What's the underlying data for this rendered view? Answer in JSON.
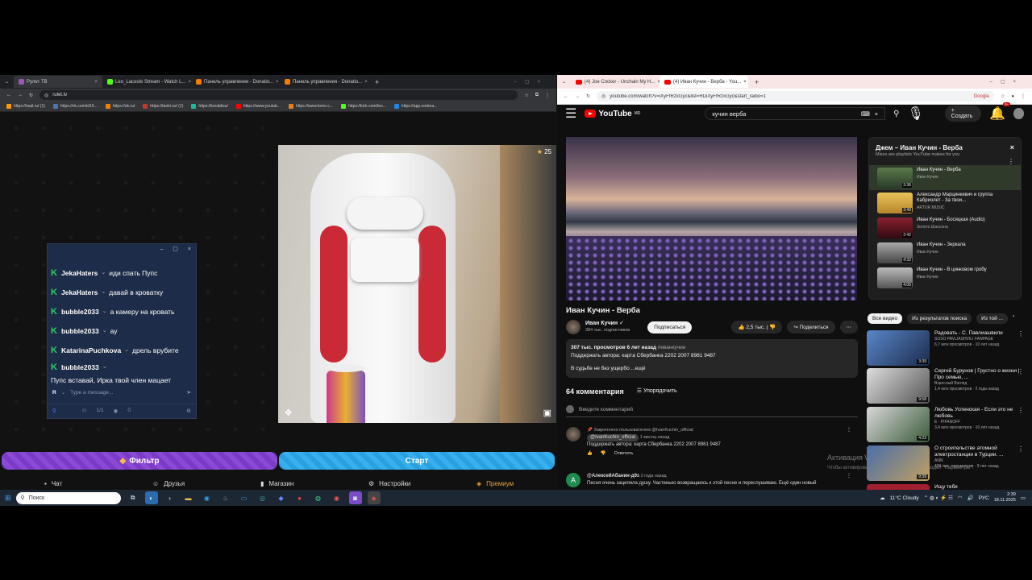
{
  "left_browser": {
    "tabs": [
      {
        "label": "Рулет ТВ",
        "color": "#9b59b6"
      },
      {
        "label": "Leo_Lacoste Stream - Watch L...",
        "color": "#53fc18"
      },
      {
        "label": "Панель управления - Donatio...",
        "color": "#f57c00"
      },
      {
        "label": "Панель управления - Donatio...",
        "color": "#f57c00"
      }
    ],
    "url": "rulet.tv",
    "bookmarks": [
      "https://mail.ru/ (1)",
      "https://vk.com/id19...",
      "https://ok.ru/",
      "https://tanki.su/ (1)",
      "https://korablisu/",
      "https://www.youtub...",
      "https://www.tomo.c...",
      "https://kick.com/leo...",
      "https://app.restrea..."
    ]
  },
  "roulette": {
    "viewer_count": "25",
    "chat": {
      "messages": [
        {
          "user": "JekaHaters",
          "text": "иди спать Пупс"
        },
        {
          "user": "JekaHaters",
          "text": "давай в кроватку"
        },
        {
          "user": "bubble2033",
          "text": "а камеру на кровать"
        },
        {
          "user": "bubble2033",
          "text": "ау"
        },
        {
          "user": "KatarinaPuchkova",
          "text": "дрель врубите"
        },
        {
          "user": "bubble2033",
          "text": "Пупс вставай, Ирка твой член мацает"
        }
      ],
      "input_placeholder": "Type a message...",
      "platform_letter": "R",
      "stats_count": "1/1",
      "stats_views": "0"
    },
    "filter_button": "Фильтр",
    "start_button": "Старт",
    "nav": {
      "chat": "Чат",
      "friends": "Друзья",
      "shop": "Магазин",
      "settings": "Настройки",
      "premium": "Премиум"
    }
  },
  "right_browser": {
    "tabs": [
      {
        "label": "(4) Joe Cocker - Unchain My H..."
      },
      {
        "label": "(4) Иван Кучин - Верба - You..."
      }
    ],
    "url": "youtube.com/watch?v=iXyFfRzxGyc&list=RDiXyFfRzxGyc&start_radio=1",
    "google_label": "Google"
  },
  "youtube": {
    "logo": "YouTube",
    "region": "MD",
    "search_query": "кучин верба",
    "create_label": "Создать",
    "notif_count": "9+",
    "video_title": "Иван Кучин - Верба",
    "channel": "Иван Кучин",
    "subscribers": "384 тыс. подписчиков",
    "subscribe_label": "Подписаться",
    "likes": "2,5 тыс.",
    "share_label": "Поделиться",
    "views": "307 тыс. просмотров",
    "age": "6 лет назад",
    "hashtag": "#иванкучин",
    "desc_line": "Поддержать автора: карта Сбербанка 2202 2007 8981 9487",
    "desc_more": "В судьбе не без ущербо ...ещё",
    "comments_count": "64 комментария",
    "sort_label": "Упорядочить",
    "comment_placeholder": "Введите комментарий",
    "pinned_by": "Закреплено пользователем @IvanKuchin_official",
    "pinned_author": "@IvanKuchin_official",
    "pinned_age": "1 месяц назад",
    "pinned_text": "Поддержать автора: карта Сбербанка 2202 2007 8981 9487",
    "reply_label": "Ответить",
    "comment2_author": "@АлексейАбанин-д9з",
    "comment2_age": "2 года назад",
    "comment2_text": "Песня очень зацепила душу. Частенько возвращаюсь к этой песне и переслушиваю. Ещё один новый",
    "activation_line1": "Активация W",
    "activation_line2": "Чтобы активировать Windows, перейдите в раздел \"Параметры\"."
  },
  "playlist": {
    "title": "Джем – Иван Кучин - Верба",
    "subtitle": "Mixes are playlists YouTube makes for you",
    "items": [
      {
        "title": "Иван Кучин - Верба",
        "author": "Иван Кучин",
        "duration": "3:36"
      },
      {
        "title": "Александр Марцинкевич и группа Кабриолет - За твои...",
        "author": "ARTUR MUSIC",
        "duration": "3:49"
      },
      {
        "title": "Иван Кучин - Босяцкая (Audio)",
        "author": "Золото Шансона",
        "duration": "2:42"
      },
      {
        "title": "Иван Кучин - Зеркала",
        "author": "Иван Кучин",
        "duration": "4:32"
      },
      {
        "title": "Иван Кучин - В цинковом гробу",
        "author": "Иван Кучин",
        "duration": "4:06"
      }
    ]
  },
  "chips": [
    "Все видео",
    "Из результатов поиска",
    "Из той ..."
  ],
  "recommended": [
    {
      "title": "Радовать - С. Павлиашвили",
      "channel": "SOSO PAVLIASHVILI FANPAGE",
      "meta": "6,7 млн просмотров · 10 лет назад",
      "duration": "3:39"
    },
    {
      "title": "Сергей Бурунов | Грустно о жизни | Про семью, ...",
      "channel": "Взрослый Взгляд",
      "meta": "1,4 млн просмотров · 2 года назад",
      "duration": "9:58"
    },
    {
      "title": "Любовь Успенская - Если это не любовь",
      "channel": "E - PIFANOFF",
      "meta": "3,4 млн просмотров · 10 лет назад",
      "duration": "4:23"
    },
    {
      "title": "О строительстве атомной электростанции в Турции. ...",
      "channel": "ANN",
      "meta": "499 тыс. просмотров · 9 лет назад",
      "duration": "9:39"
    },
    {
      "title": "Ищу тебя",
      "channel": "",
      "meta": "",
      "duration": ""
    }
  ],
  "taskbar": {
    "search_placeholder": "Поиск",
    "weather": "11°C  Cloudy",
    "lang": "РУС",
    "time": "2:39",
    "date": "18.11.2025"
  }
}
